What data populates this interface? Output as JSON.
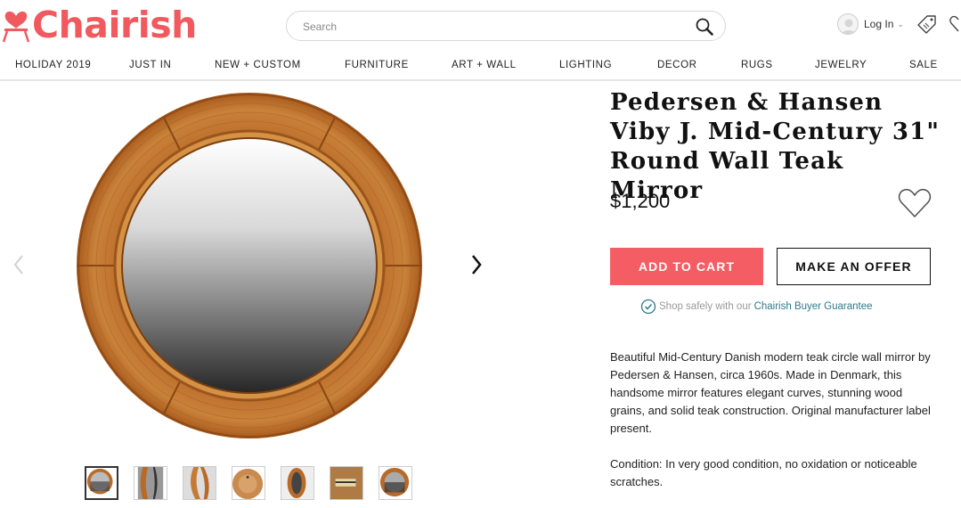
{
  "header": {
    "logo_text": "Chairish",
    "search_placeholder": "Search",
    "login_label": "Log In",
    "brand_color": "#f05a5f"
  },
  "nav": {
    "items": [
      "HOLIDAY 2019",
      "JUST IN",
      "NEW + CUSTOM",
      "FURNITURE",
      "ART + WALL",
      "LIGHTING",
      "DECOR",
      "RUGS",
      "JEWELRY",
      "SALE"
    ]
  },
  "gallery": {
    "prev_icon": "chevron-left-icon",
    "next_icon": "chevron-right-icon",
    "thumbnail_count": 7,
    "active_thumbnail": 1
  },
  "product": {
    "title": "Pedersen & Hansen Viby J. Mid-Century 31\" Round Wall Teak Mirror",
    "price": "$1,200",
    "add_to_cart_label": "ADD TO CART",
    "make_offer_label": "MAKE AN OFFER",
    "guarantee_text": "Shop safely with our",
    "guarantee_link": "Chairish Buyer Guarantee",
    "description": "Beautiful Mid-Century Danish modern teak circle wall mirror by Pedersen & Hansen, circa 1960s. Made in Denmark, this handsome mirror features elegant curves, stunning wood grains, and solid teak construction. Original manufacturer label present.",
    "condition": "Condition: In very good condition, no oxidation or noticeable scratches.",
    "accent_color": "#f45d63",
    "link_color": "#2e7a8a"
  }
}
